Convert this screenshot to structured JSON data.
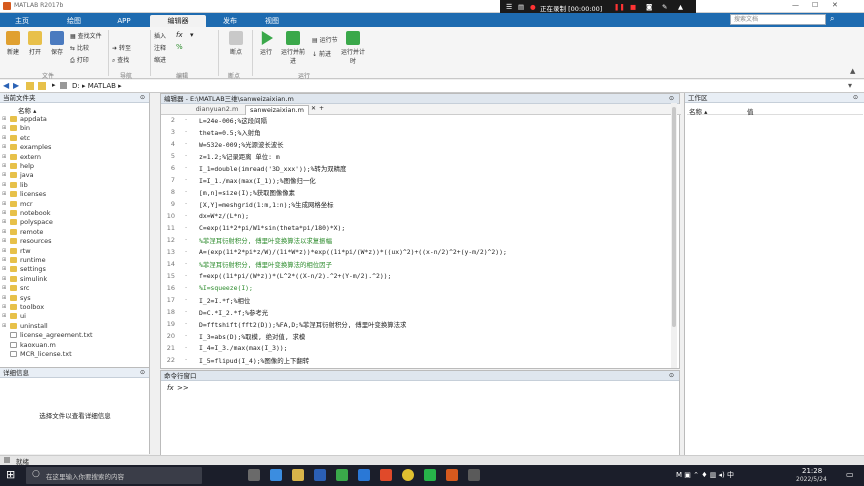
{
  "window": {
    "title": "MATLAB R2017b"
  },
  "recorder": {
    "label": "正在录制 [00:00:00]"
  },
  "tabs": [
    {
      "label": "主页"
    },
    {
      "label": "绘图"
    },
    {
      "label": "APP"
    },
    {
      "label": "编辑器"
    },
    {
      "label": "发布"
    },
    {
      "label": "视图"
    }
  ],
  "search": {
    "placeholder": "搜索文档"
  },
  "ribbon": {
    "buttons": [
      {
        "label": "新建"
      },
      {
        "label": "打开"
      },
      {
        "label": "保存"
      },
      {
        "label": "查找文件"
      },
      {
        "label": "比较"
      },
      {
        "label": "打印"
      },
      {
        "label": "转至"
      },
      {
        "label": "查找"
      },
      {
        "label": "插入"
      },
      {
        "label": "注释"
      },
      {
        "label": "缩进"
      },
      {
        "label": "断点"
      },
      {
        "label": "运行"
      },
      {
        "label": "运行并前进"
      },
      {
        "label": "运行节"
      },
      {
        "label": "前进"
      },
      {
        "label": "运行并计时"
      }
    ],
    "groups": [
      {
        "label": "文件"
      },
      {
        "label": "导航"
      },
      {
        "label": "编辑"
      },
      {
        "label": "断点"
      },
      {
        "label": "运行"
      }
    ]
  },
  "address": {
    "path": "D: ▸ MATLAB ▸"
  },
  "current_folder": {
    "title": "当前文件夹",
    "column": "名称 ▴",
    "items": [
      {
        "name": "appdata",
        "folder": true
      },
      {
        "name": "bin",
        "folder": true
      },
      {
        "name": "etc",
        "folder": true
      },
      {
        "name": "examples",
        "folder": true
      },
      {
        "name": "extern",
        "folder": true
      },
      {
        "name": "help",
        "folder": true
      },
      {
        "name": "java",
        "folder": true
      },
      {
        "name": "lib",
        "folder": true
      },
      {
        "name": "licenses",
        "folder": true
      },
      {
        "name": "mcr",
        "folder": true
      },
      {
        "name": "notebook",
        "folder": true
      },
      {
        "name": "polyspace",
        "folder": true
      },
      {
        "name": "remote",
        "folder": true
      },
      {
        "name": "resources",
        "folder": true
      },
      {
        "name": "rtw",
        "folder": true
      },
      {
        "name": "runtime",
        "folder": true
      },
      {
        "name": "settings",
        "folder": true
      },
      {
        "name": "simulink",
        "folder": true
      },
      {
        "name": "src",
        "folder": true
      },
      {
        "name": "sys",
        "folder": true
      },
      {
        "name": "toolbox",
        "folder": true
      },
      {
        "name": "ui",
        "folder": true
      },
      {
        "name": "uninstall",
        "folder": true
      },
      {
        "name": "license_agreement.txt",
        "folder": false
      },
      {
        "name": "kaoxuan.m",
        "folder": false
      },
      {
        "name": "MCR_license.txt",
        "folder": false
      }
    ]
  },
  "details": {
    "title": "详细信息",
    "message": "选择文件以查看详细信息"
  },
  "editor": {
    "title": "编辑器 - E:\\MATLAB三维\\sanweizaixian.m",
    "tabs": [
      {
        "label": "dianyuan2.m"
      },
      {
        "label": "sanweizaixian.m"
      }
    ],
    "lines": [
      {
        "n": "2",
        "code": "L=24e-006;%这段间隔"
      },
      {
        "n": "3",
        "code": "theta=0.5;%入射角"
      },
      {
        "n": "4",
        "code": "W=532e-009;%光源波长波长"
      },
      {
        "n": "5",
        "code": "z=1.2;%记录距离 单位: m"
      },
      {
        "n": "6",
        "code": "I_1=double(imread('3D_xxx'));%转为双精度"
      },
      {
        "n": "7",
        "code": "I=I_1./max(max(I_1));%图像归一化"
      },
      {
        "n": "8",
        "code": "[m,n]=size(I);%获取图像像素"
      },
      {
        "n": "9",
        "code": "[X,Y]=meshgrid(1:m,1:n);%生成网格坐标"
      },
      {
        "n": "10",
        "code": "dx=W*z/(L*n);"
      },
      {
        "n": "11",
        "code": "C=exp(1i*2*pi/W1*sin(theta*pi/180)*X);"
      },
      {
        "n": "12",
        "code": "%菲涅耳衍射积分, 傅里叶变换算法以求复振幅"
      },
      {
        "n": "13",
        "code": "A=(exp(1i*2*pi*z/W)/(1i*W*z))*exp((1i*pi/(W*z))*((ux)^2)+((x-n/2)^2+(y-m/2)^2));"
      },
      {
        "n": "14",
        "code": "%菲涅耳衍射积分, 傅里叶变换算法的相位因子"
      },
      {
        "n": "15",
        "code": "f=exp((1i*pi/(W*z))*(L^2*((X-n/2).^2+(Y-m/2).^2));"
      },
      {
        "n": "16",
        "code": "%I=squeeze(I);"
      },
      {
        "n": "17",
        "code": "I_2=I.*f;%相位"
      },
      {
        "n": "18",
        "code": "D=C.*I_2.*f;%参考光"
      },
      {
        "n": "19",
        "code": "D=fftshift(fft2(D));%FA,D;%菲涅耳衍射积分, 傅里叶变换算法求"
      },
      {
        "n": "20",
        "code": "I_3=abs(D);%取模, 绝对值, 求模"
      },
      {
        "n": "21",
        "code": "I_4=I_3./max(max(I_3));"
      },
      {
        "n": "22",
        "code": "I_5=flipud(I_4);%图像的上下翻转"
      }
    ]
  },
  "command_window": {
    "title": "命令行窗口",
    "prompt": ">>"
  },
  "workspace": {
    "title": "工作区",
    "col_name": "名称 ▴",
    "col_value": "值"
  },
  "statusbar": {
    "text": "就绪"
  },
  "taskbar": {
    "search_placeholder": "在这里输入你要搜索的内容",
    "time": "21:28",
    "date": "2022/5/24"
  }
}
